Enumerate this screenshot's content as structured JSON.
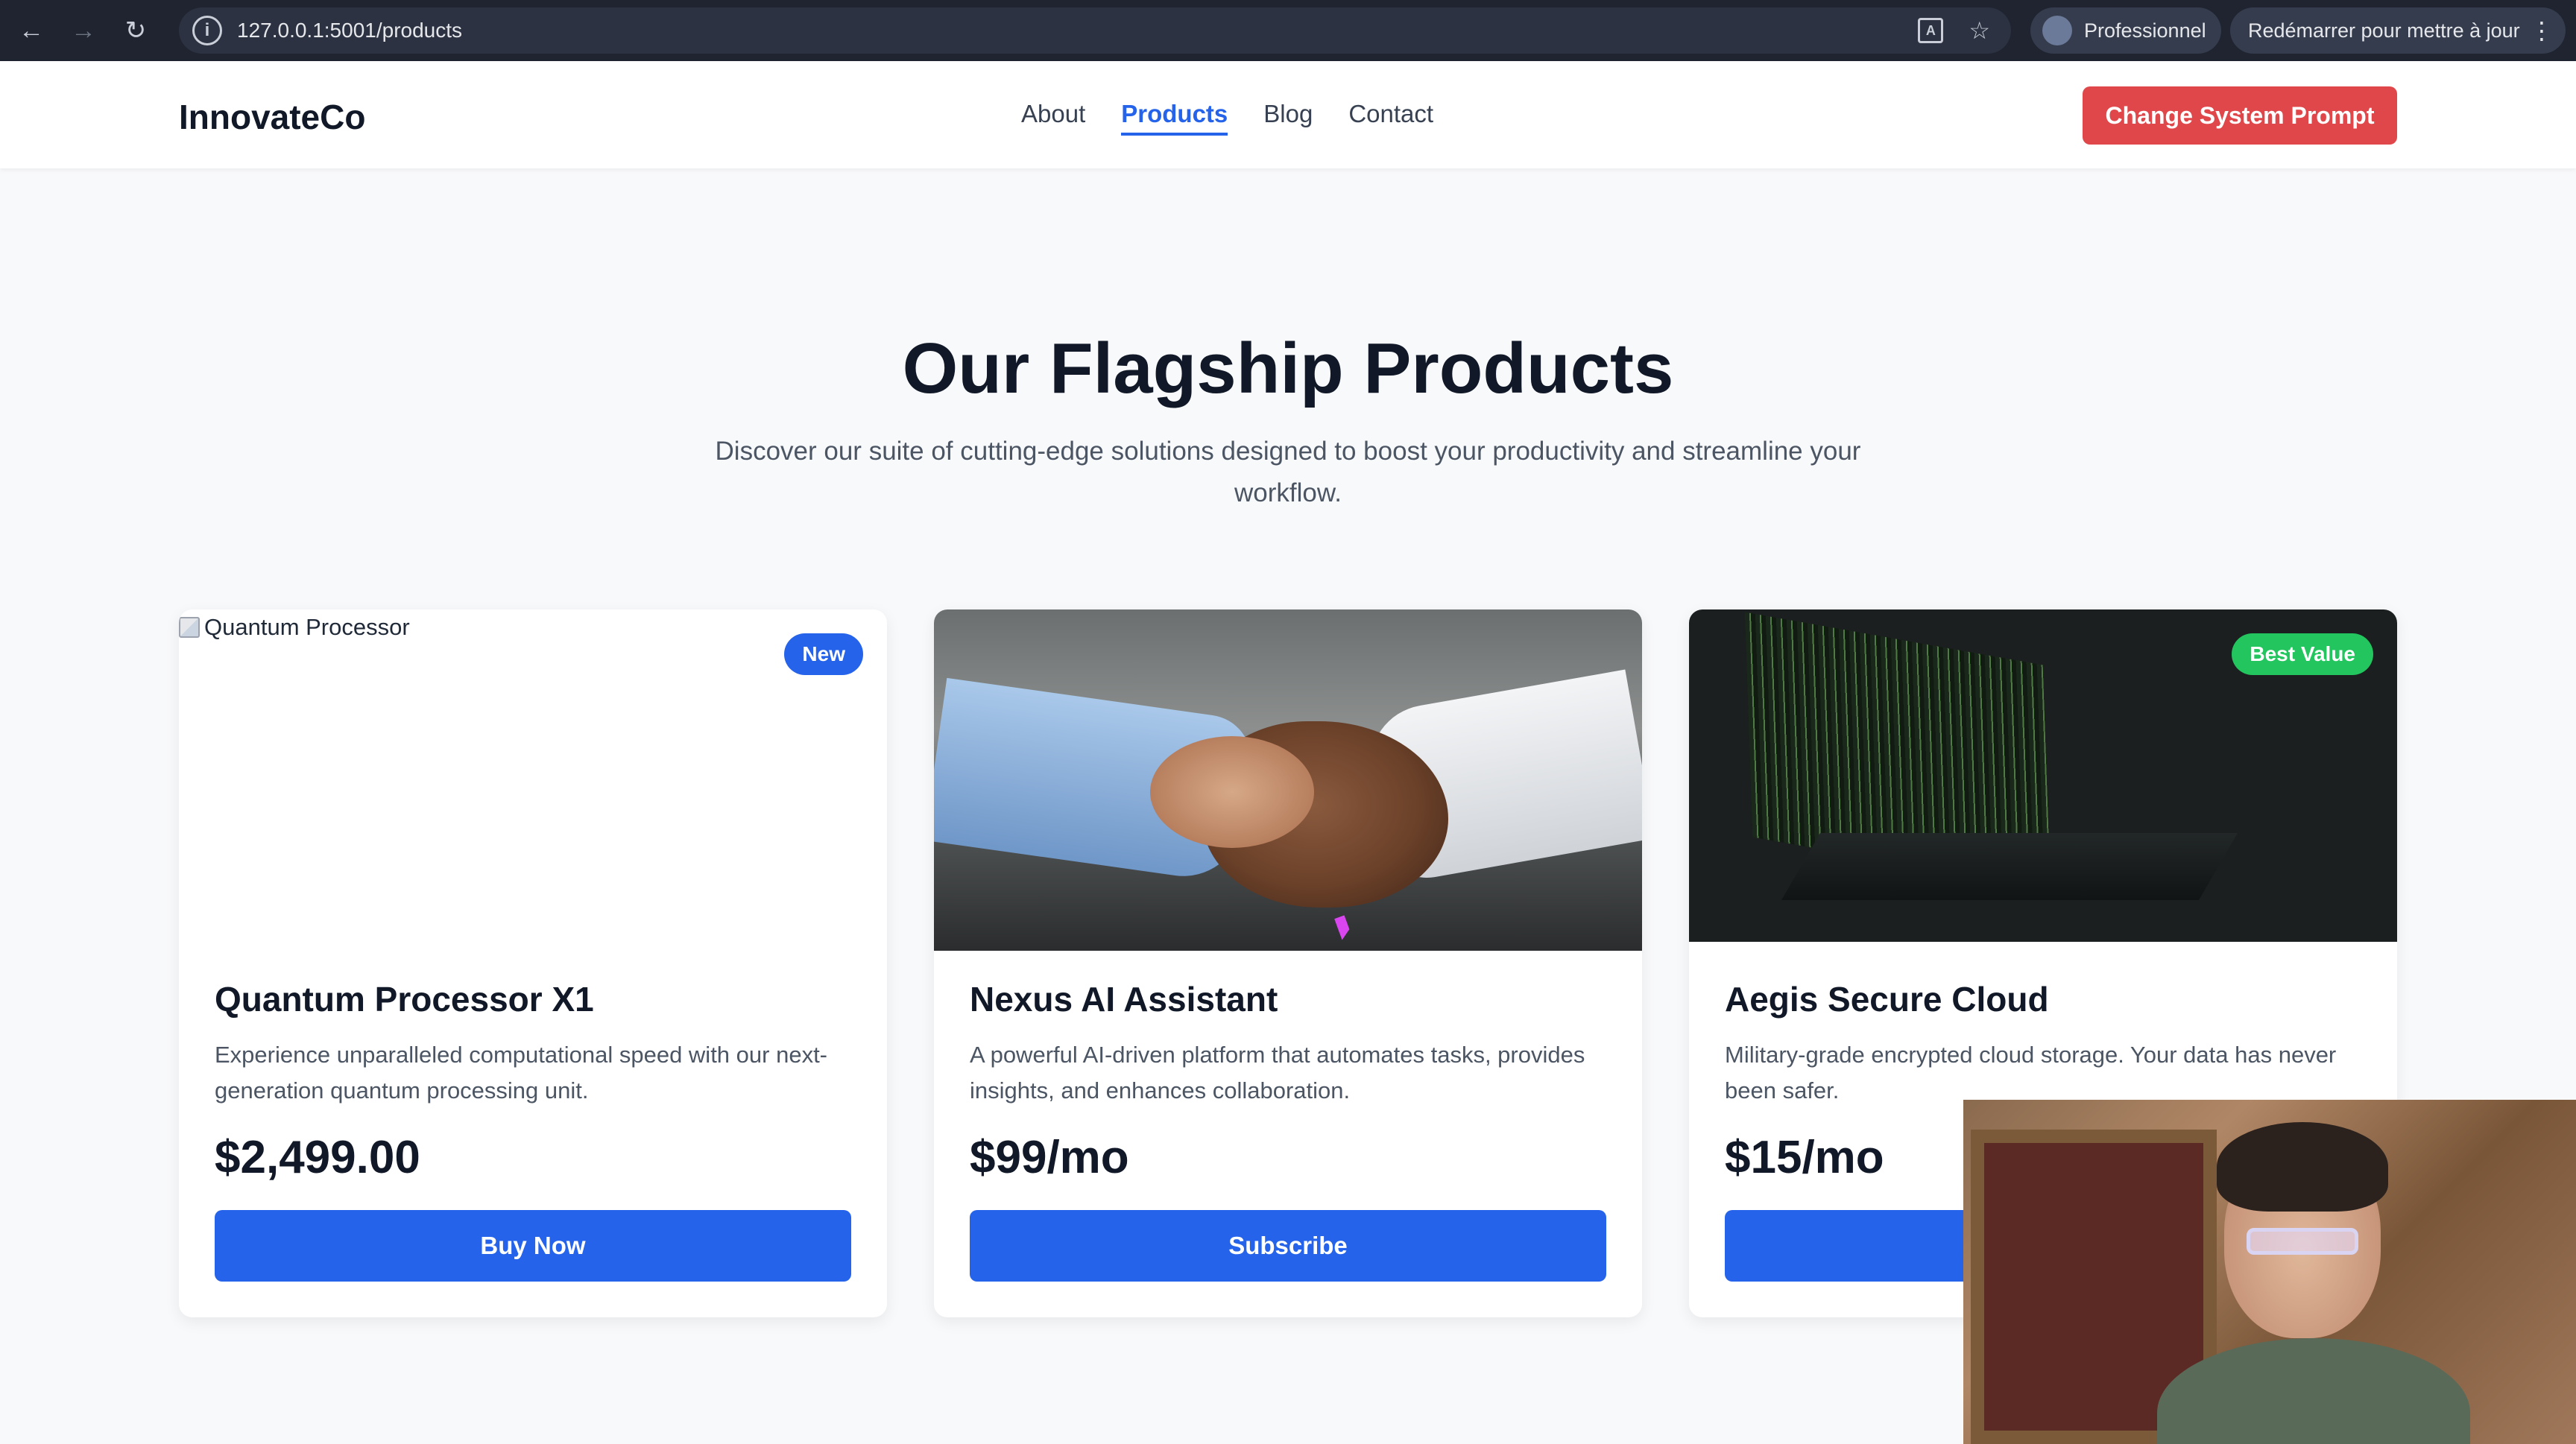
{
  "browser": {
    "url": "127.0.0.1:5001/products",
    "profile_label": "Professionnel",
    "update_label": "Redémarrer pour mettre à jour"
  },
  "header": {
    "logo": "InnovateCo",
    "nav": [
      {
        "label": "About",
        "active": false
      },
      {
        "label": "Products",
        "active": true
      },
      {
        "label": "Blog",
        "active": false
      },
      {
        "label": "Contact",
        "active": false
      }
    ],
    "cta_label": "Change System Prompt"
  },
  "hero": {
    "title": "Our Flagship Products",
    "subtitle": "Discover our suite of cutting-edge solutions designed to boost your productivity and streamline your workflow."
  },
  "products": [
    {
      "image_alt": "Quantum Processor",
      "badge": "New",
      "title": "Quantum Processor X1",
      "description": "Experience unparalleled computational speed with our next-generation quantum processing unit.",
      "price": "$2,499.00",
      "button": "Buy Now"
    },
    {
      "badge": "",
      "title": "Nexus AI Assistant",
      "description": "A powerful AI-driven platform that automates tasks, provides insights, and enhances collaboration.",
      "price": "$99/mo",
      "button": "Subscribe"
    },
    {
      "badge": "Best Value",
      "title": "Aegis Secure Cloud",
      "description": "Military-grade encrypted cloud storage. Your data has never been safer.",
      "price": "$15/mo",
      "button": ""
    }
  ],
  "colors": {
    "brand_blue": "#2563eb",
    "cta_red": "#e0474a",
    "badge_green": "#22c55e"
  }
}
